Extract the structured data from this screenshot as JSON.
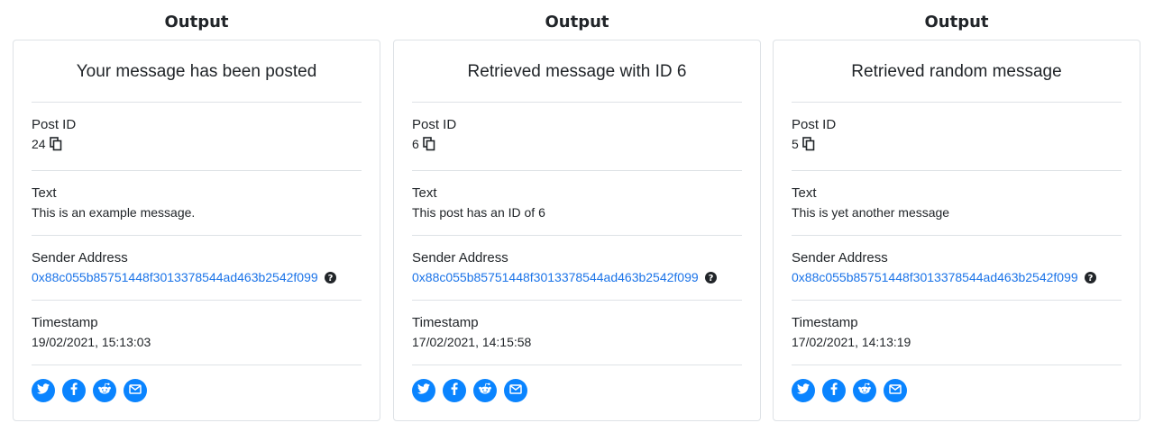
{
  "cards": [
    {
      "heading": "Output",
      "title": "Your message has been posted",
      "post_id_label": "Post ID",
      "post_id": "24",
      "text_label": "Text",
      "text": "This is an example message.",
      "sender_label": "Sender Address",
      "sender": "0x88c055b85751448f3013378544ad463b2542f099",
      "timestamp_label": "Timestamp",
      "timestamp": "19/02/2021, 15:13:03"
    },
    {
      "heading": "Output",
      "title": "Retrieved message with ID 6",
      "post_id_label": "Post ID",
      "post_id": "6",
      "text_label": "Text",
      "text": "This post has an ID of 6",
      "sender_label": "Sender Address",
      "sender": "0x88c055b85751448f3013378544ad463b2542f099",
      "timestamp_label": "Timestamp",
      "timestamp": "17/02/2021, 14:15:58"
    },
    {
      "heading": "Output",
      "title": "Retrieved random message",
      "post_id_label": "Post ID",
      "post_id": "5",
      "text_label": "Text",
      "text": "This is yet another message",
      "sender_label": "Sender Address",
      "sender": "0x88c055b85751448f3013378544ad463b2542f099",
      "timestamp_label": "Timestamp",
      "timestamp": "17/02/2021, 14:13:19"
    }
  ],
  "share_icons": [
    "twitter-icon",
    "facebook-icon",
    "reddit-icon",
    "email-icon"
  ],
  "colors": {
    "accent": "#0a84ff",
    "link": "#1a73e8",
    "border": "#dee2e6",
    "text": "#212529"
  }
}
